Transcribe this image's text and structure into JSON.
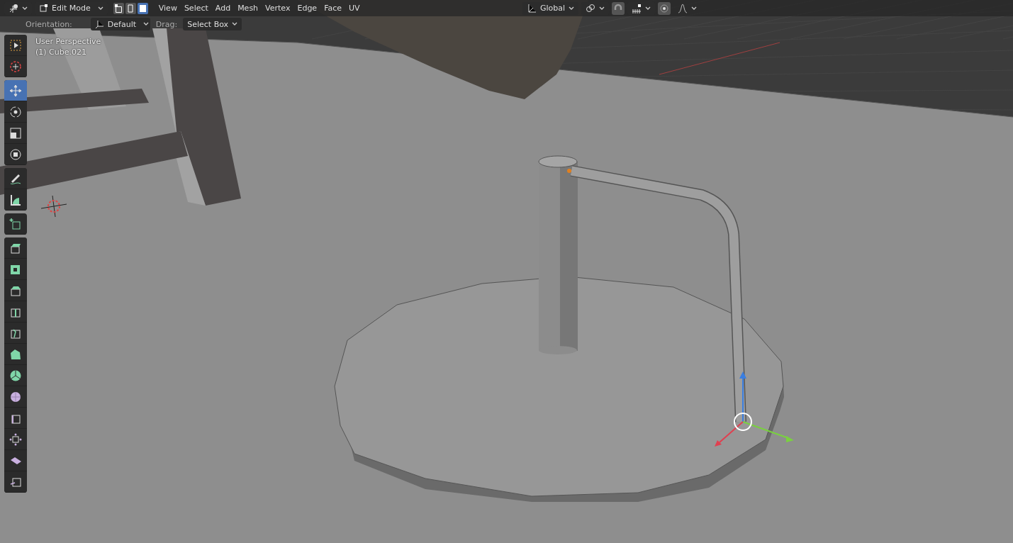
{
  "header": {
    "mode": "Edit Mode",
    "select_modes": [
      {
        "kind": "vertex",
        "selected": false
      },
      {
        "kind": "edge",
        "selected": false
      },
      {
        "kind": "face",
        "selected": true
      }
    ],
    "menus": [
      "View",
      "Select",
      "Add",
      "Mesh",
      "Vertex",
      "Edge",
      "Face",
      "UV"
    ],
    "orientation": "Global"
  },
  "tool_settings": {
    "orientation_label": "Orientation:",
    "orientation": "Default",
    "drag_label": "Drag:",
    "drag": "Select Box"
  },
  "viewport": {
    "view_name": "User Perspective",
    "object": "(1) Cube.021"
  },
  "toolbar": {
    "groups": [
      {
        "tools": [
          {
            "kind": "select",
            "selected": false
          },
          {
            "kind": "cursor",
            "selected": false
          }
        ]
      },
      {
        "tools": [
          {
            "kind": "move",
            "selected": true
          },
          {
            "kind": "rotate",
            "selected": false
          },
          {
            "kind": "scale",
            "selected": false
          },
          {
            "kind": "transform",
            "selected": false
          }
        ]
      },
      {
        "tools": [
          {
            "kind": "annotate",
            "selected": false
          },
          {
            "kind": "measure",
            "selected": false
          }
        ]
      },
      {
        "tools": [
          {
            "kind": "add",
            "selected": false
          }
        ]
      },
      {
        "tools": [
          {
            "kind": "extrude",
            "selected": false
          },
          {
            "kind": "inset",
            "selected": false
          },
          {
            "kind": "bevel",
            "selected": false
          },
          {
            "kind": "loopcut",
            "selected": false
          },
          {
            "kind": "knife",
            "selected": false
          },
          {
            "kind": "polybuild",
            "selected": false
          },
          {
            "kind": "spin",
            "selected": false
          },
          {
            "kind": "smooth",
            "selected": false
          },
          {
            "kind": "slide",
            "selected": false
          },
          {
            "kind": "shrink",
            "selected": false
          },
          {
            "kind": "shear",
            "selected": false
          },
          {
            "kind": "rip",
            "selected": false
          }
        ]
      }
    ]
  }
}
